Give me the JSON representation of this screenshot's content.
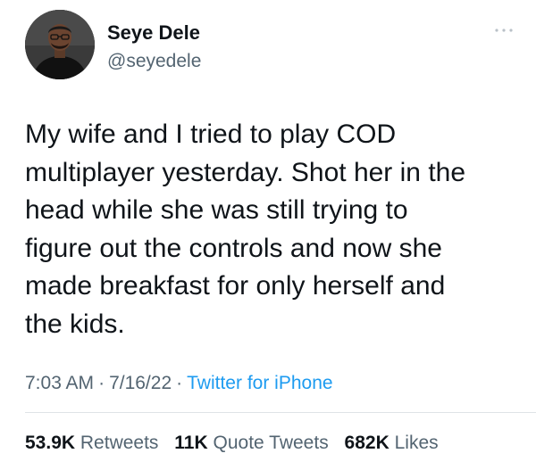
{
  "user": {
    "display_name": "Seye Dele",
    "handle": "@seyedele"
  },
  "tweet": {
    "text": "My wife and I tried to play COD\nmultiplayer yesterday. Shot her in the\nhead while she was still trying to\nfigure out the controls and now she\nmade breakfast for only herself and\nthe kids.",
    "time": "7:03 AM",
    "date": "7/16/22",
    "source": "Twitter for iPhone",
    "separator": "·"
  },
  "stats": {
    "retweets_count": "53.9K",
    "retweets_label": "Retweets",
    "quotes_count": "11K",
    "quotes_label": "Quote Tweets",
    "likes_count": "682K",
    "likes_label": "Likes"
  },
  "icons": {
    "more": "more-horizontal-icon"
  },
  "colors": {
    "text_primary": "#0f1419",
    "text_secondary": "#536471",
    "link": "#1d9bf0",
    "divider": "#dfe3e6"
  }
}
